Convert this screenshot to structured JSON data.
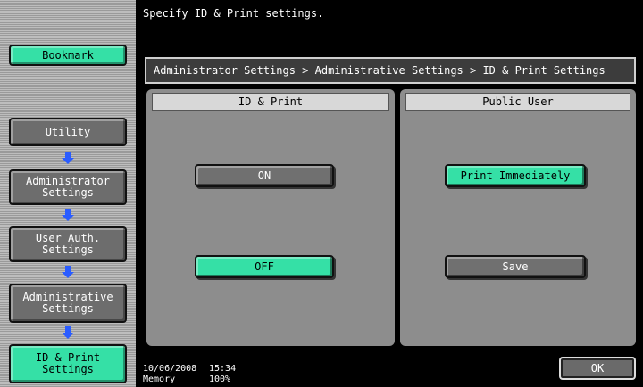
{
  "message": "Specify ID & Print settings.",
  "sidebar": {
    "bookmark": "Bookmark",
    "items": [
      {
        "label": "Utility"
      },
      {
        "label": "Administrator Settings"
      },
      {
        "label": "User Auth. Settings"
      },
      {
        "label": "Administrative Settings"
      },
      {
        "label": "ID & Print Settings"
      }
    ]
  },
  "breadcrumb": "Administrator Settings > Administrative Settings > ID & Print Settings",
  "panels": {
    "id_print": {
      "header": "ID & Print",
      "on_label": "ON",
      "off_label": "OFF",
      "selected": "OFF"
    },
    "public_user": {
      "header": "Public User",
      "print_immediately_label": "Print Immediately",
      "save_label": "Save",
      "selected": "Print Immediately"
    }
  },
  "status": {
    "date": "10/06/2008",
    "time": "15:34",
    "memory_label": "Memory",
    "memory_value": "100%"
  },
  "ok_label": "OK",
  "colors": {
    "selected": "#35e0a6",
    "unselected": "#707070",
    "arrow": "#2a5cff"
  }
}
